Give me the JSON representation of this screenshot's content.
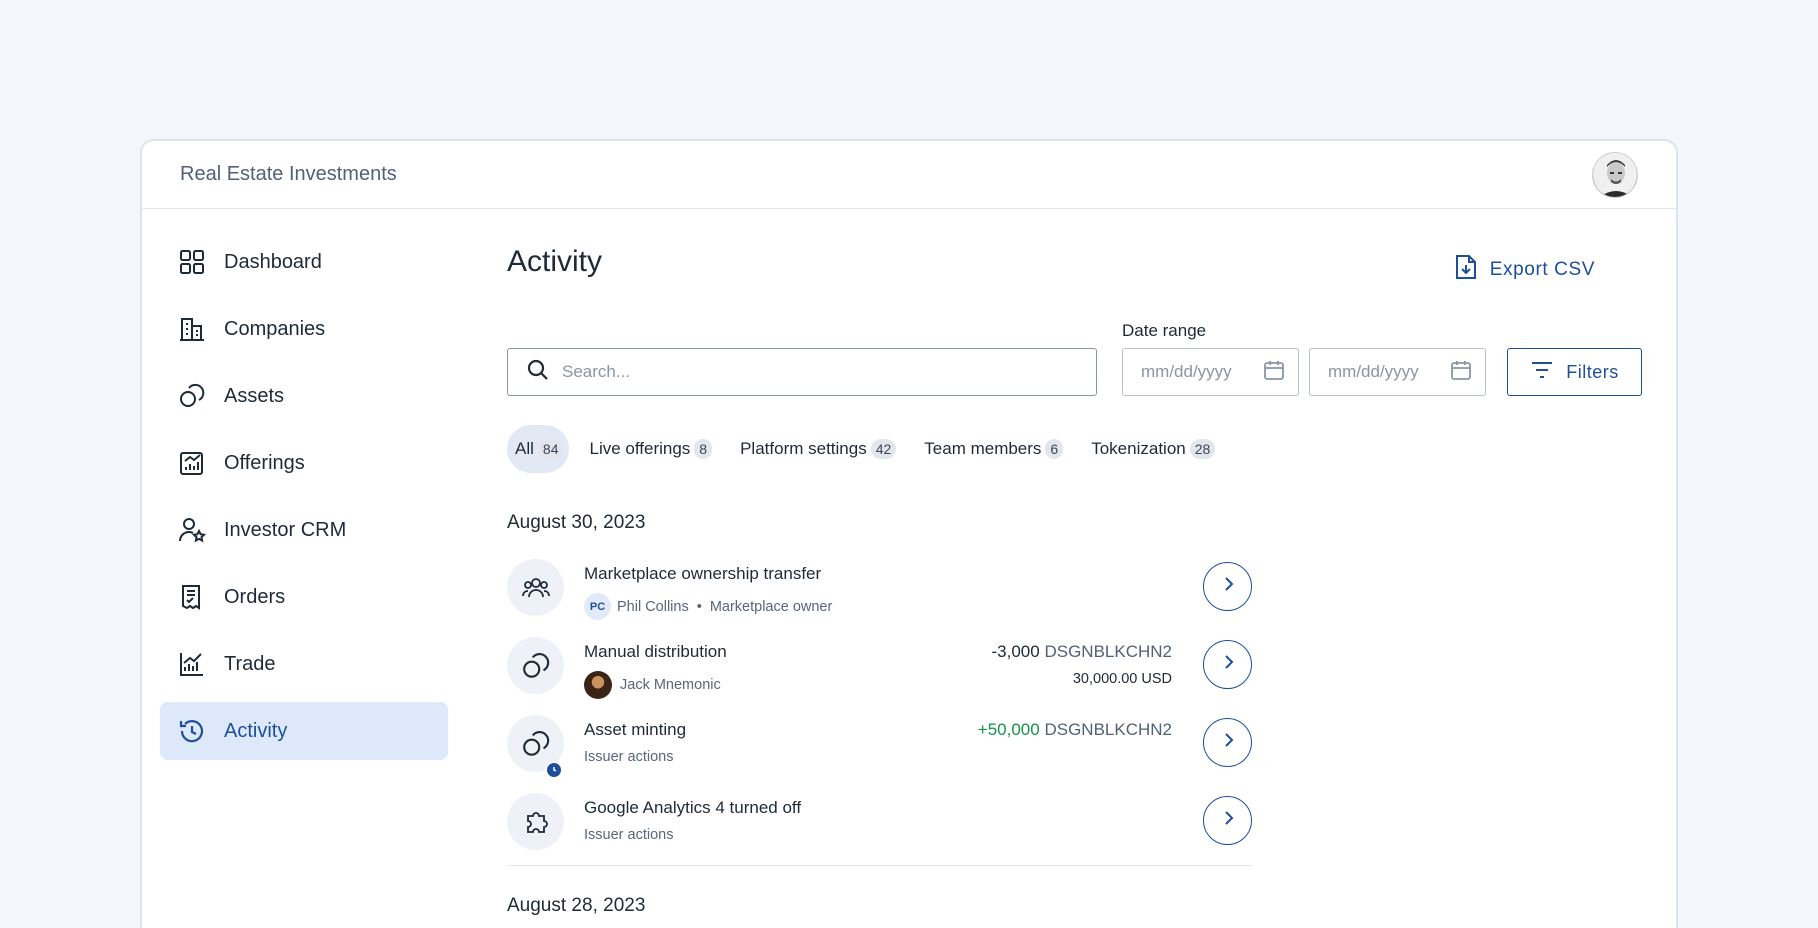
{
  "app": {
    "title": "Real Estate Investments"
  },
  "sidebar": {
    "items": [
      {
        "label": "Dashboard",
        "icon": "dashboard-icon"
      },
      {
        "label": "Companies",
        "icon": "building-icon"
      },
      {
        "label": "Assets",
        "icon": "coins-icon"
      },
      {
        "label": "Offerings",
        "icon": "offerings-chart-icon"
      },
      {
        "label": "Investor CRM",
        "icon": "user-star-icon"
      },
      {
        "label": "Orders",
        "icon": "receipt-check-icon"
      },
      {
        "label": "Trade",
        "icon": "line-chart-icon"
      },
      {
        "label": "Activity",
        "icon": "history-icon",
        "active": true
      }
    ]
  },
  "main": {
    "title": "Activity",
    "export_label": "Export CSV",
    "search": {
      "placeholder": "Search..."
    },
    "date_range": {
      "label": "Date range",
      "start_placeholder": "mm/dd/yyyy",
      "end_placeholder": "mm/dd/yyyy"
    },
    "filters_label": "Filters",
    "tabs": [
      {
        "label": "All",
        "count": "84",
        "active": true
      },
      {
        "label": "Live offerings",
        "count": "8"
      },
      {
        "label": "Platform settings",
        "count": "42"
      },
      {
        "label": "Team members",
        "count": "6"
      },
      {
        "label": "Tokenization",
        "count": "28"
      }
    ],
    "groups": [
      {
        "date": "August 30, 2023",
        "items": [
          {
            "title": "Marketplace ownership transfer",
            "initials": "PC",
            "user": "Phil Collins",
            "role": "Marketplace owner",
            "icon": "users-icon"
          },
          {
            "title": "Manual distribution",
            "user": "Jack Mnemonic",
            "amount": "-3,000",
            "token": "DSGNBLKCHN2",
            "amount_sub": "30,000.00 USD",
            "icon": "coins-icon"
          },
          {
            "title": "Asset minting",
            "subtitle": "Issuer actions",
            "amount": "+50,000",
            "token": "DSGNBLKCHN2",
            "icon": "coins-clock-icon"
          },
          {
            "title": "Google Analytics 4 turned off",
            "subtitle": "Issuer actions",
            "icon": "puzzle-icon"
          }
        ]
      },
      {
        "date": "August 28, 2023"
      }
    ]
  },
  "colors": {
    "accent": "#1d4f9a",
    "active_bg": "#dde8fb",
    "positive": "#16924a"
  }
}
